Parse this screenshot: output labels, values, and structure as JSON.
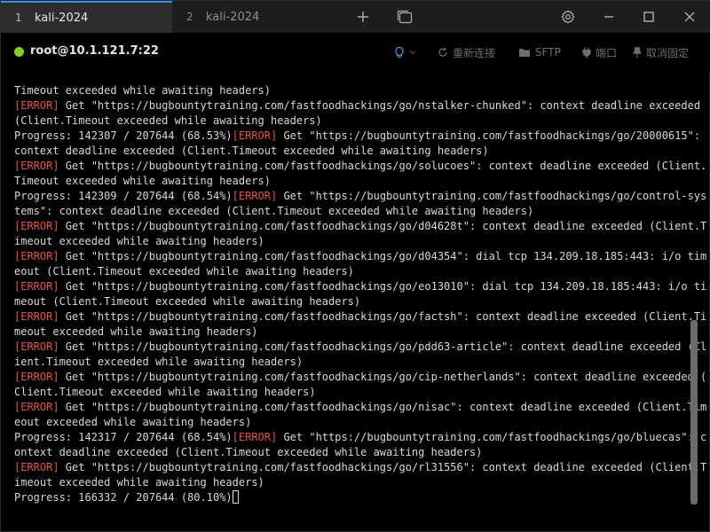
{
  "tabs": [
    {
      "num": "1",
      "label": "kali-2024"
    },
    {
      "num": "2",
      "label": "kali-2024"
    }
  ],
  "toolbar": {
    "new_tab_icon": "plus-icon",
    "tab_list_icon": "tab-list-icon",
    "settings_icon": "gear-icon",
    "minimize_icon": "minimize-icon",
    "maximize_icon": "maximize-icon",
    "close_icon": "close-icon"
  },
  "session": {
    "host": "root@10.1.121.7:22",
    "status_color": "#7ed321",
    "reconnect": "重新连接",
    "sftp": "SFTP",
    "port": "端口",
    "unpin": "取消固定"
  },
  "colors": {
    "error": "#e5534b",
    "accent": "#3a8ee6"
  },
  "terminal": {
    "lines": [
      [
        {
          "t": "Timeout exceeded while awaiting headers)"
        }
      ],
      [
        {
          "t": "[ERROR]",
          "err": true
        },
        {
          "t": " Get \"https://bugbountytraining.com/fastfoodhackings/go/nstalker-chunked\": context deadline exceeded"
        }
      ],
      [
        {
          "t": "(Client.Timeout exceeded while awaiting headers)"
        }
      ],
      [
        {
          "t": "Progress: 142307 / 207644 (68.53%)"
        },
        {
          "t": "[ERROR]",
          "err": true
        },
        {
          "t": " Get \"https://bugbountytraining.com/fastfoodhackings/go/20000615\":"
        }
      ],
      [
        {
          "t": "context deadline exceeded (Client.Timeout exceeded while awaiting headers)"
        }
      ],
      [
        {
          "t": "[ERROR]",
          "err": true
        },
        {
          "t": " Get \"https://bugbountytraining.com/fastfoodhackings/go/solucoes\": context deadline exceeded (Client."
        }
      ],
      [
        {
          "t": "Timeout exceeded while awaiting headers)"
        }
      ],
      [
        {
          "t": "Progress: 142309 / 207644 (68.54%)"
        },
        {
          "t": "[ERROR]",
          "err": true
        },
        {
          "t": " Get \"https://bugbountytraining.com/fastfoodhackings/go/control-sys"
        }
      ],
      [
        {
          "t": "tems\": context deadline exceeded (Client.Timeout exceeded while awaiting headers)"
        }
      ],
      [
        {
          "t": "[ERROR]",
          "err": true
        },
        {
          "t": " Get \"https://bugbountytraining.com/fastfoodhackings/go/d04628t\": context deadline exceeded (Client.T"
        }
      ],
      [
        {
          "t": "imeout exceeded while awaiting headers)"
        }
      ],
      [
        {
          "t": "[ERROR]",
          "err": true
        },
        {
          "t": " Get \"https://bugbountytraining.com/fastfoodhackings/go/d04354\": dial tcp 134.209.18.185:443: i/o tim"
        }
      ],
      [
        {
          "t": "eout (Client.Timeout exceeded while awaiting headers)"
        }
      ],
      [
        {
          "t": "[ERROR]",
          "err": true
        },
        {
          "t": " Get \"https://bugbountytraining.com/fastfoodhackings/go/eo13010\": dial tcp 134.209.18.185:443: i/o ti"
        }
      ],
      [
        {
          "t": "meout (Client.Timeout exceeded while awaiting headers)"
        }
      ],
      [
        {
          "t": "[ERROR]",
          "err": true
        },
        {
          "t": " Get \"https://bugbountytraining.com/fastfoodhackings/go/factsh\": context deadline exceeded (Client.Ti"
        }
      ],
      [
        {
          "t": "meout exceeded while awaiting headers)"
        }
      ],
      [
        {
          "t": "[ERROR]",
          "err": true
        },
        {
          "t": " Get \"https://bugbountytraining.com/fastfoodhackings/go/pdd63-article\": context deadline exceeded (Cl"
        }
      ],
      [
        {
          "t": "ient.Timeout exceeded while awaiting headers)"
        }
      ],
      [
        {
          "t": "[ERROR]",
          "err": true
        },
        {
          "t": " Get \"https://bugbountytraining.com/fastfoodhackings/go/cip-netherlands\": context deadline exceeded ("
        }
      ],
      [
        {
          "t": "Client.Timeout exceeded while awaiting headers)"
        }
      ],
      [
        {
          "t": "[ERROR]",
          "err": true
        },
        {
          "t": " Get \"https://bugbountytraining.com/fastfoodhackings/go/nisac\": context deadline exceeded (Client.Tim"
        }
      ],
      [
        {
          "t": "eout exceeded while awaiting headers)"
        }
      ],
      [
        {
          "t": "Progress: 142317 / 207644 (68.54%)"
        },
        {
          "t": "[ERROR]",
          "err": true
        },
        {
          "t": " Get \"https://bugbountytraining.com/fastfoodhackings/go/bluecas\": c"
        }
      ],
      [
        {
          "t": "ontext deadline exceeded (Client.Timeout exceeded while awaiting headers)"
        }
      ],
      [
        {
          "t": "[ERROR]",
          "err": true
        },
        {
          "t": " Get \"https://bugbountytraining.com/fastfoodhackings/go/rl31556\": context deadline exceeded (Client.T"
        }
      ],
      [
        {
          "t": "imeout exceeded while awaiting headers)"
        }
      ],
      [
        {
          "t": "Progress: 166332 / 207644 (80.10%)"
        }
      ]
    ]
  }
}
